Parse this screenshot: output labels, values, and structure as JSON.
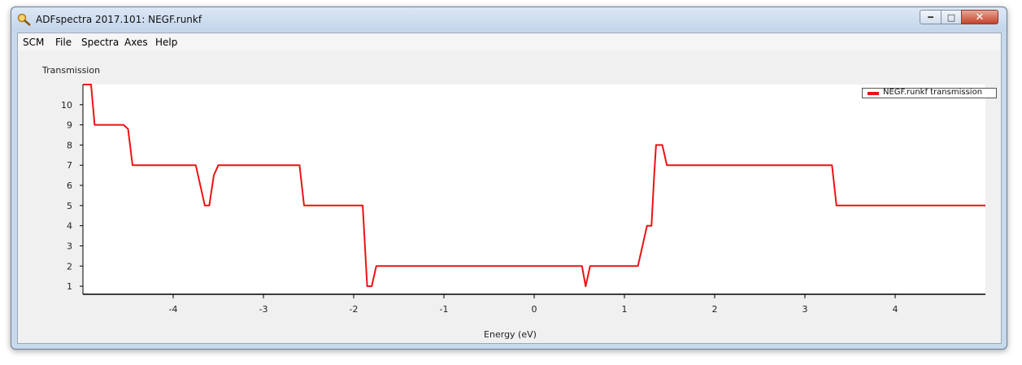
{
  "window": {
    "title": "ADFspectra 2017.101: NEGF.runkf",
    "min_icon": "minimize-icon",
    "max_icon": "maximize-icon",
    "close_icon": "close-icon"
  },
  "menu": {
    "items": [
      "SCM",
      "File",
      "Spectra",
      "Axes",
      "Help"
    ]
  },
  "plot_title": "Transmission",
  "chart_data": {
    "type": "line",
    "title": "Transmission",
    "xlabel": "Energy (eV)",
    "ylabel": "",
    "xlim": [
      -5,
      5
    ],
    "ylim": [
      0.6,
      11
    ],
    "xticks": [
      -4,
      -3,
      -2,
      -1,
      0,
      1,
      2,
      3,
      4
    ],
    "yticks": [
      1,
      2,
      3,
      4,
      5,
      6,
      7,
      8,
      9,
      10
    ],
    "grid": false,
    "legend": "top-right",
    "series": [
      {
        "name": "NEGF.runkf transmission",
        "color": "#ee1111",
        "x": [
          -5,
          -4.91,
          -4.87,
          -4.82,
          -4.8,
          -4.55,
          -4.5,
          -4.45,
          -4.2,
          -3.75,
          -3.65,
          -3.6,
          -3.55,
          -3.5,
          -3.45,
          -2.6,
          -2.55,
          -2.2,
          -1.9,
          -1.85,
          -1.8,
          -1.75,
          -1.7,
          0.53,
          0.57,
          0.62,
          1.1,
          1.15,
          1.2,
          1.25,
          1.3,
          1.33,
          1.35,
          1.42,
          1.47,
          1.7,
          3.0,
          3.3,
          3.35,
          3.4,
          5
        ],
        "y": [
          11,
          11,
          9,
          9,
          9,
          9,
          8.8,
          7,
          7,
          7,
          5,
          5,
          6.5,
          7,
          7,
          7,
          5,
          5,
          5,
          1,
          1,
          2,
          2,
          2,
          1,
          2,
          2,
          2,
          3,
          4,
          4,
          6.5,
          8,
          8,
          7,
          7,
          7,
          7,
          5,
          5,
          5
        ]
      }
    ]
  }
}
